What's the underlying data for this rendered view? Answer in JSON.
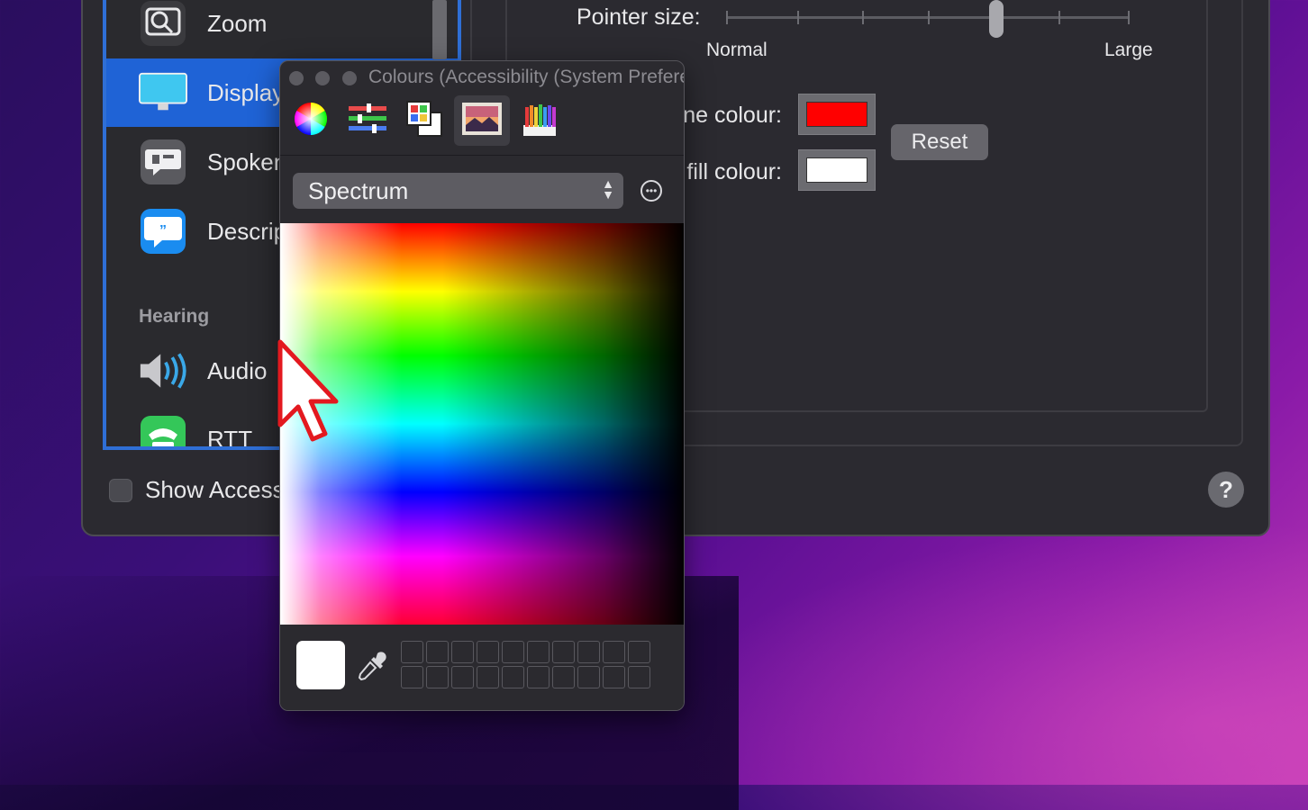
{
  "sidebar": {
    "items": [
      {
        "label": "Zoom",
        "icon": "zoom-icon"
      },
      {
        "label": "Display",
        "icon": "display-icon"
      },
      {
        "label": "Spoken Content",
        "icon": "spoken-content-icon"
      },
      {
        "label": "Descriptions",
        "icon": "descriptions-icon"
      },
      {
        "label": "Audio",
        "icon": "audio-icon"
      },
      {
        "label": "RTT",
        "icon": "rtt-icon"
      }
    ],
    "section_header": "Hearing"
  },
  "footer": {
    "show_accessibility_label": "Show Accessibility status in menu bar",
    "show_accessibility_checked": false
  },
  "display_panel": {
    "pointer_size_label": "Pointer size:",
    "slider_min_label": "Normal",
    "slider_max_label": "Large",
    "pointer_size_fraction": 0.67,
    "outline_colour_label": "Pointer outline colour:",
    "fill_colour_label": "Pointer fill colour:",
    "outline_colour": "#ff0000",
    "fill_colour": "#ffffff",
    "reset_label": "Reset",
    "help_label": "?"
  },
  "colours_panel": {
    "title": "Colours (Accessibility (System Preferences))",
    "modes": [
      "colour-wheel-icon",
      "colour-sliders-icon",
      "colour-palettes-icon",
      "image-palettes-icon",
      "pencils-icon"
    ],
    "active_mode": "image-palettes-icon",
    "palette_select": "Spectrum",
    "current_colour": "#ffffff"
  }
}
